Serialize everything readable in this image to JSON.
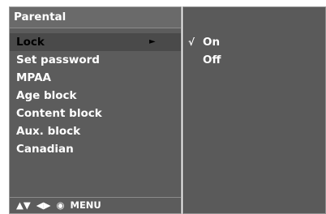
{
  "menu": {
    "title": "Parental",
    "items": [
      {
        "label": "Lock"
      },
      {
        "label": "Set password"
      },
      {
        "label": "MPAA"
      },
      {
        "label": "Age block"
      },
      {
        "label": "Content block"
      },
      {
        "label": "Aux. block"
      },
      {
        "label": "Canadian"
      }
    ],
    "selected_item": "Lock"
  },
  "submenu": {
    "options": [
      {
        "label": "On",
        "selected": true
      },
      {
        "label": "Off",
        "selected": false
      }
    ]
  },
  "footer": {
    "nav_hint_label": "MENU"
  },
  "icons": {
    "selected_arrow": "play-arrow-icon",
    "check": "check-icon",
    "up_down": "up-down-arrows-icon",
    "left_right": "left-right-arrows-icon",
    "ok": "ok-circle-icon"
  },
  "colors": {
    "panel_background": "#5c5c5c",
    "panel_title_background": "#6a6a6a",
    "selected_row_background": "#4a4a4a",
    "text": "#ffffff",
    "selected_text": "#000000"
  }
}
